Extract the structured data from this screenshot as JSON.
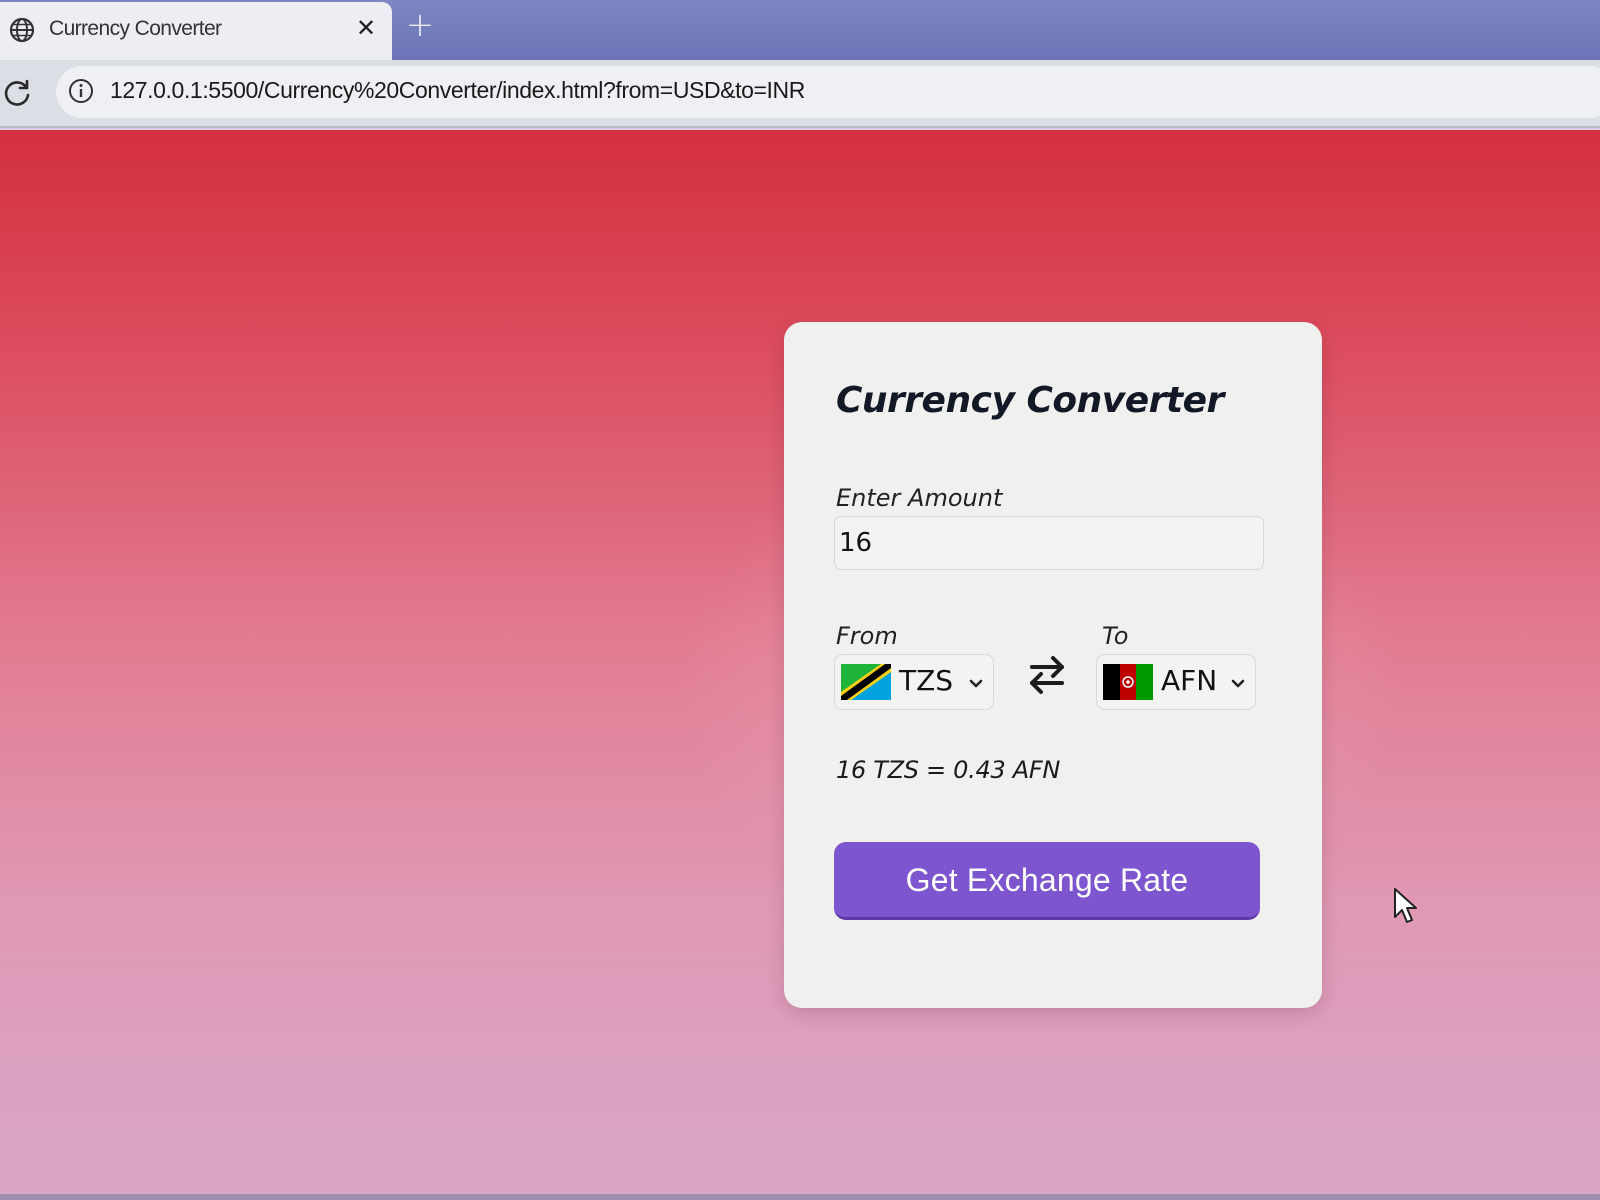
{
  "browser": {
    "tab_title": "Currency Converter",
    "new_tab_symbol": "+",
    "close_symbol": "✕",
    "url": "127.0.0.1:5500/Currency%20Converter/index.html?from=USD&to=INR"
  },
  "converter": {
    "title": "Currency Converter",
    "amount_label": "Enter Amount",
    "amount_value": "16",
    "from_label": "From",
    "to_label": "To",
    "from_currency": "TZS",
    "to_currency": "AFN",
    "result": "16 TZS = 0.43 AFN",
    "button_label": "Get Exchange Rate"
  },
  "icons": {
    "tab": "globe-icon",
    "reload": "reload-icon",
    "site_info": "info-icon",
    "swap": "swap-arrows-icon",
    "dropdown": "chevron-down-icon",
    "from_flag": "tanzania-flag",
    "to_flag": "afghanistan-flag"
  },
  "colors": {
    "button": "#7d55cf",
    "background_top": "#d42f3f",
    "background_bottom": "#d9a7c9",
    "card": "#f0f1ee"
  }
}
